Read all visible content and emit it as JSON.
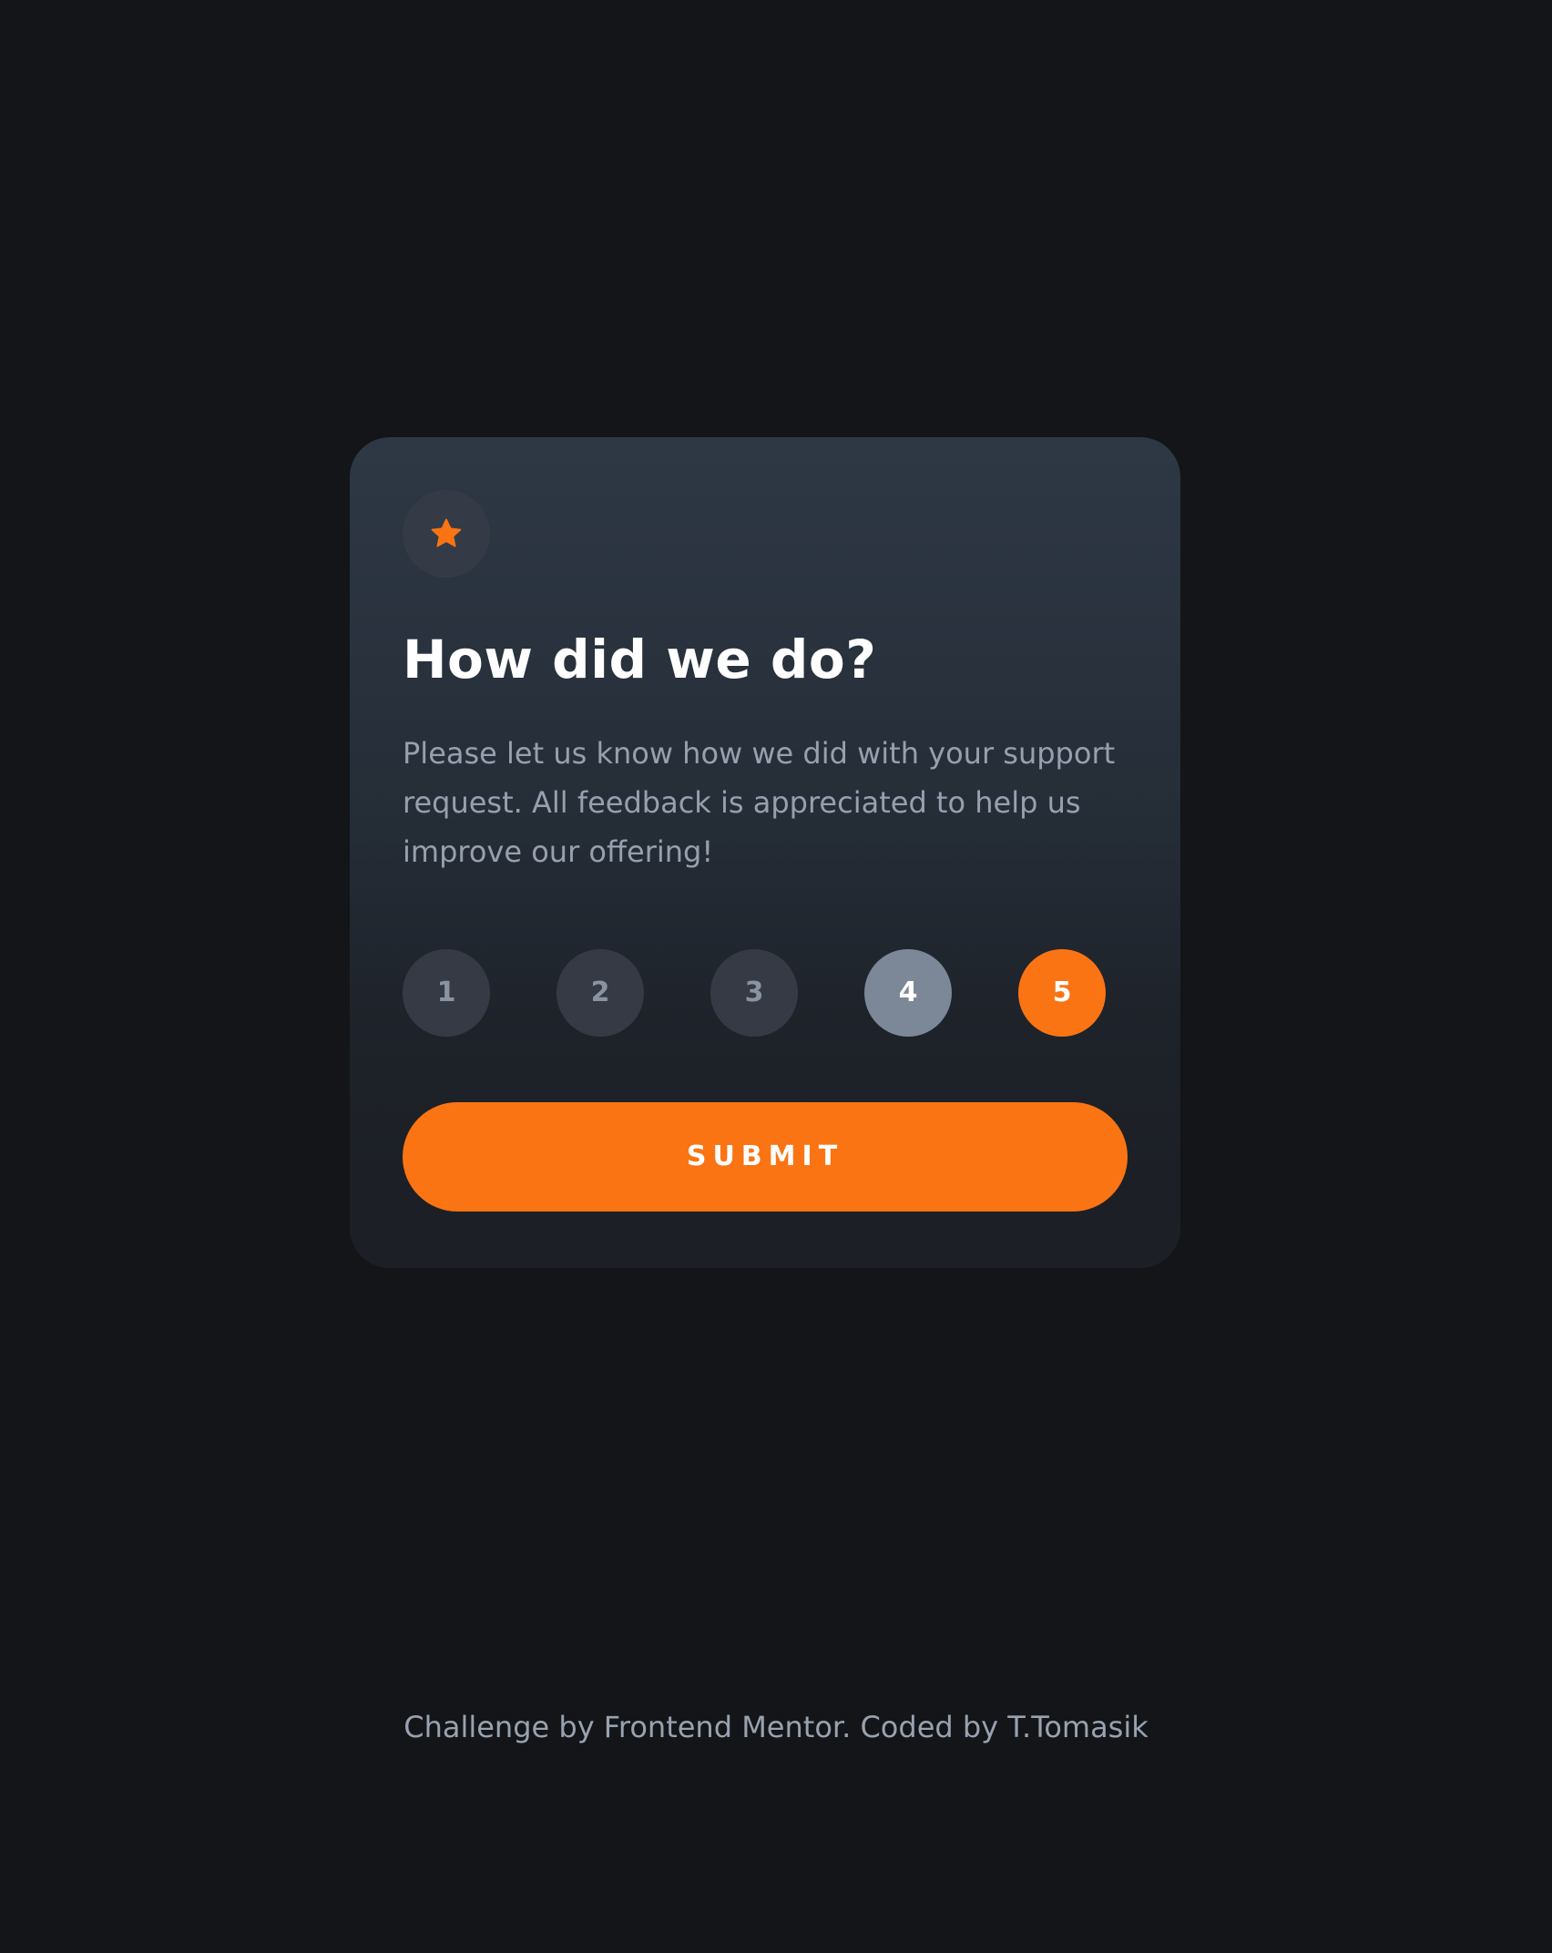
{
  "card": {
    "icon": "star-icon",
    "title": "How did we do?",
    "description": "Please let us know how we did with your support request. All feedback is appreciated to help us improve our offering!",
    "ratings": [
      "1",
      "2",
      "3",
      "4",
      "5"
    ],
    "hovered_rating": "4",
    "selected_rating": "5",
    "submit_label": "SUBMIT"
  },
  "footer": {
    "text": "Challenge by Frontend Mentor. Coded by T.Tomasik"
  },
  "colors": {
    "accent": "#fb7413",
    "page_background": "#131518",
    "rating_default": "#363a45",
    "rating_hover": "#7c8798"
  }
}
